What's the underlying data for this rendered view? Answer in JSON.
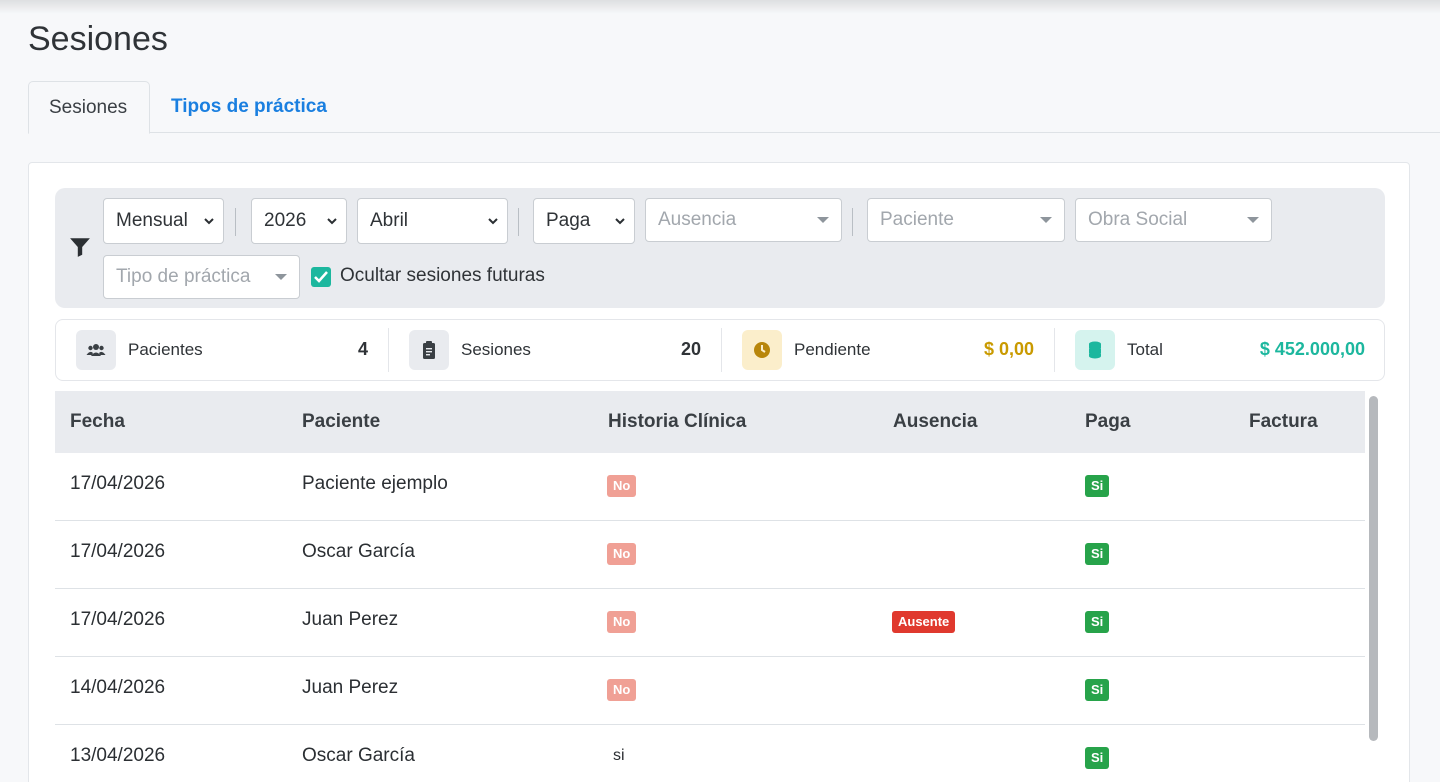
{
  "page": {
    "title": "Sesiones"
  },
  "tabs": [
    {
      "label": "Sesiones",
      "active": true
    },
    {
      "label": "Tipos de práctica",
      "active": false
    }
  ],
  "filters": {
    "periodo": "Mensual",
    "anio": "2026",
    "mes": "Abril",
    "paga": "Paga",
    "ausencia_placeholder": "Ausencia",
    "paciente_placeholder": "Paciente",
    "obra_social_placeholder": "Obra Social",
    "tipo_practica_placeholder": "Tipo de práctica",
    "ocultar_label": "Ocultar sesiones futuras",
    "ocultar_checked": true
  },
  "stats": [
    {
      "label": "Pacientes",
      "value": "4",
      "icon": "users-icon",
      "color": "#2f3337"
    },
    {
      "label": "Sesiones",
      "value": "20",
      "icon": "clipboard-icon",
      "color": "#2f3337"
    },
    {
      "label": "Pendiente",
      "value": "$ 0,00",
      "icon": "clock-icon",
      "color": "#c99a00"
    },
    {
      "label": "Total",
      "value": "$ 452.000,00",
      "icon": "coins-icon",
      "color": "#1cb79e"
    }
  ],
  "table": {
    "headers": [
      "Fecha",
      "Paciente",
      "Historia Clínica",
      "Ausencia",
      "Paga",
      "Factura"
    ],
    "rows": [
      {
        "fecha": "17/04/2026",
        "paciente": "Paciente ejemplo",
        "historia": "No",
        "ausencia": "",
        "paga": "Si"
      },
      {
        "fecha": "17/04/2026",
        "paciente": "Oscar García",
        "historia": "No",
        "ausencia": "",
        "paga": "Si"
      },
      {
        "fecha": "17/04/2026",
        "paciente": "Juan Perez",
        "historia": "No",
        "ausencia": "Ausente",
        "paga": "Si"
      },
      {
        "fecha": "14/04/2026",
        "paciente": "Juan Perez",
        "historia": "No",
        "ausencia": "",
        "paga": "Si"
      },
      {
        "fecha": "13/04/2026",
        "paciente": "Oscar García",
        "historia": "si",
        "ausencia": "",
        "paga": "Si"
      }
    ]
  },
  "colors": {
    "link": "#1a7fe0",
    "badge_no": "#f0a095",
    "badge_si": "#27a34a",
    "badge_ausente": "#e0392e",
    "checkbox": "#1cb79e"
  }
}
